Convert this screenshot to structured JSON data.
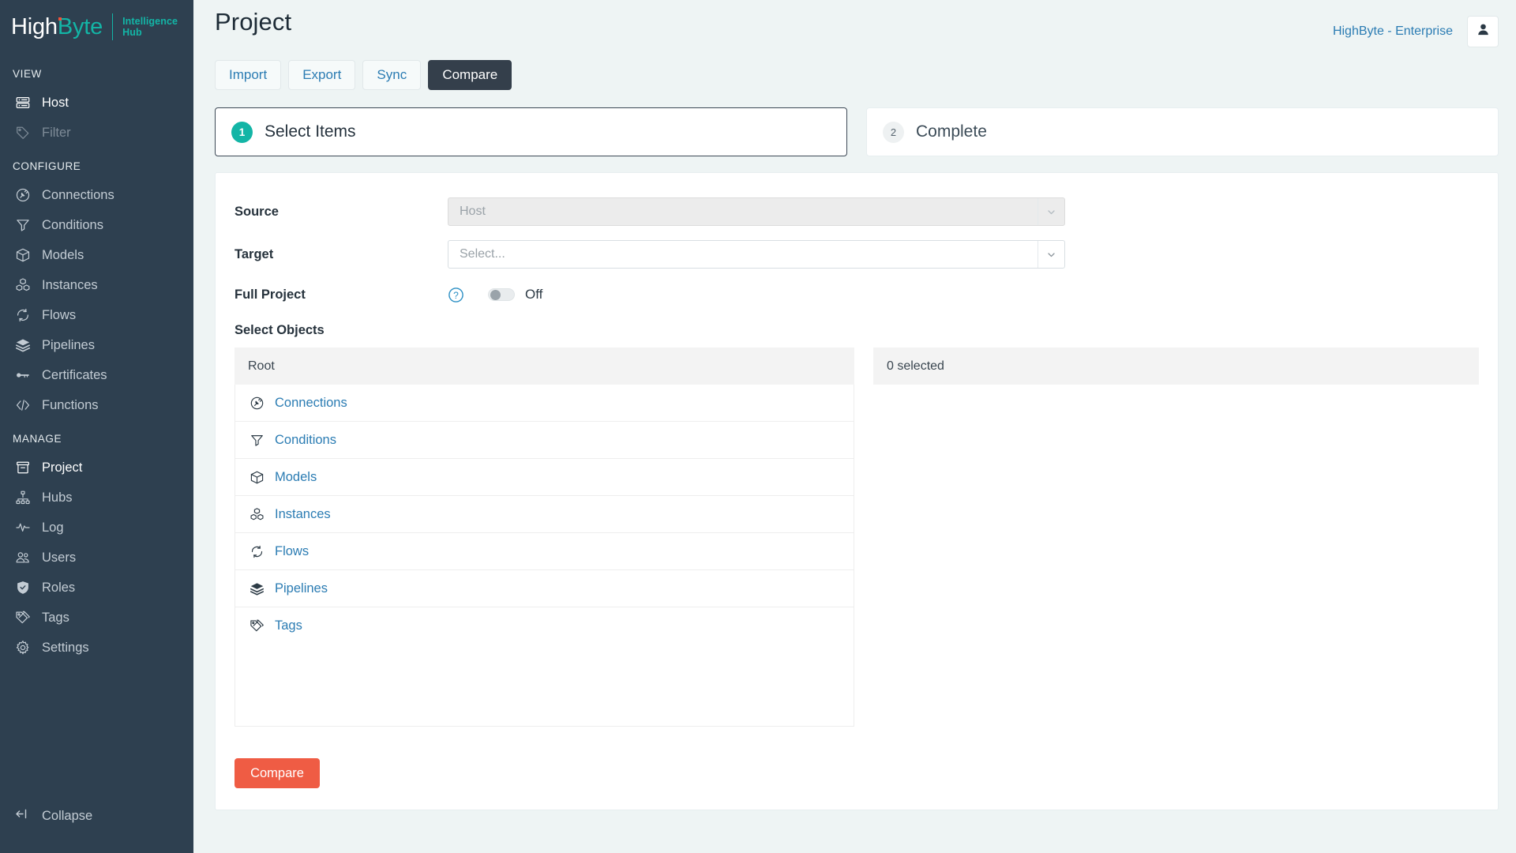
{
  "brand": {
    "name_part1": "High",
    "name_part2": "Byte",
    "subtitle_line1": "Intelligence",
    "subtitle_line2": "Hub",
    "accent_teal": "#13b5a6",
    "accent_orange": "#ef5138",
    "sidebar_bg": "#2e4050"
  },
  "sidebar": {
    "sections": [
      {
        "label": "VIEW",
        "items": [
          {
            "label": "Host",
            "icon": "server-icon",
            "state": "active"
          },
          {
            "label": "Filter",
            "icon": "tag-icon",
            "state": "disabled"
          }
        ]
      },
      {
        "label": "CONFIGURE",
        "items": [
          {
            "label": "Connections",
            "icon": "plug-circle-icon",
            "state": "normal"
          },
          {
            "label": "Conditions",
            "icon": "funnel-icon",
            "state": "normal"
          },
          {
            "label": "Models",
            "icon": "cube-icon",
            "state": "normal"
          },
          {
            "label": "Instances",
            "icon": "cubes-icon",
            "state": "normal"
          },
          {
            "label": "Flows",
            "icon": "refresh-icon",
            "state": "normal"
          },
          {
            "label": "Pipelines",
            "icon": "layers-icon",
            "state": "normal"
          },
          {
            "label": "Certificates",
            "icon": "key-icon",
            "state": "normal"
          },
          {
            "label": "Functions",
            "icon": "code-icon",
            "state": "normal"
          }
        ]
      },
      {
        "label": "MANAGE",
        "items": [
          {
            "label": "Project",
            "icon": "archive-icon",
            "state": "active"
          },
          {
            "label": "Hubs",
            "icon": "sitemap-icon",
            "state": "normal"
          },
          {
            "label": "Log",
            "icon": "pulse-icon",
            "state": "normal"
          },
          {
            "label": "Users",
            "icon": "users-icon",
            "state": "normal"
          },
          {
            "label": "Roles",
            "icon": "shield-check-icon",
            "state": "normal"
          },
          {
            "label": "Tags",
            "icon": "tags-icon",
            "state": "normal"
          },
          {
            "label": "Settings",
            "icon": "gear-icon",
            "state": "normal"
          }
        ]
      }
    ],
    "collapse_label": "Collapse",
    "collapse_icon": "collapse-left-icon"
  },
  "header": {
    "title": "Project",
    "tenant": "HighByte - Enterprise",
    "avatar_icon": "user-icon"
  },
  "tabs": [
    {
      "label": "Import",
      "active": false
    },
    {
      "label": "Export",
      "active": false
    },
    {
      "label": "Sync",
      "active": false
    },
    {
      "label": "Compare",
      "active": true
    }
  ],
  "steps": [
    {
      "number": "1",
      "label": "Select Items",
      "state": "current"
    },
    {
      "number": "2",
      "label": "Complete",
      "state": "inactive"
    }
  ],
  "form": {
    "source": {
      "label": "Source",
      "value": "Host",
      "readonly": true,
      "caret_icon": "chevron-down-icon"
    },
    "target": {
      "label": "Target",
      "placeholder": "Select...",
      "value": "",
      "caret_icon": "chevron-down-icon"
    },
    "full_project": {
      "label": "Full Project",
      "help_icon": "question-circle-icon",
      "toggle_state": "Off",
      "toggle_on": false
    },
    "select_objects_label": "Select Objects"
  },
  "object_picker": {
    "left_header": "Root",
    "right_header": "0 selected",
    "items": [
      {
        "label": "Connections",
        "icon": "plug-circle-icon"
      },
      {
        "label": "Conditions",
        "icon": "funnel-icon"
      },
      {
        "label": "Models",
        "icon": "cube-icon"
      },
      {
        "label": "Instances",
        "icon": "cubes-icon"
      },
      {
        "label": "Flows",
        "icon": "refresh-icon"
      },
      {
        "label": "Pipelines",
        "icon": "layers-icon"
      },
      {
        "label": "Tags",
        "icon": "tags-icon"
      }
    ],
    "selected_items": []
  },
  "actions": {
    "compare_label": "Compare",
    "compare_color": "#ef5c44"
  }
}
